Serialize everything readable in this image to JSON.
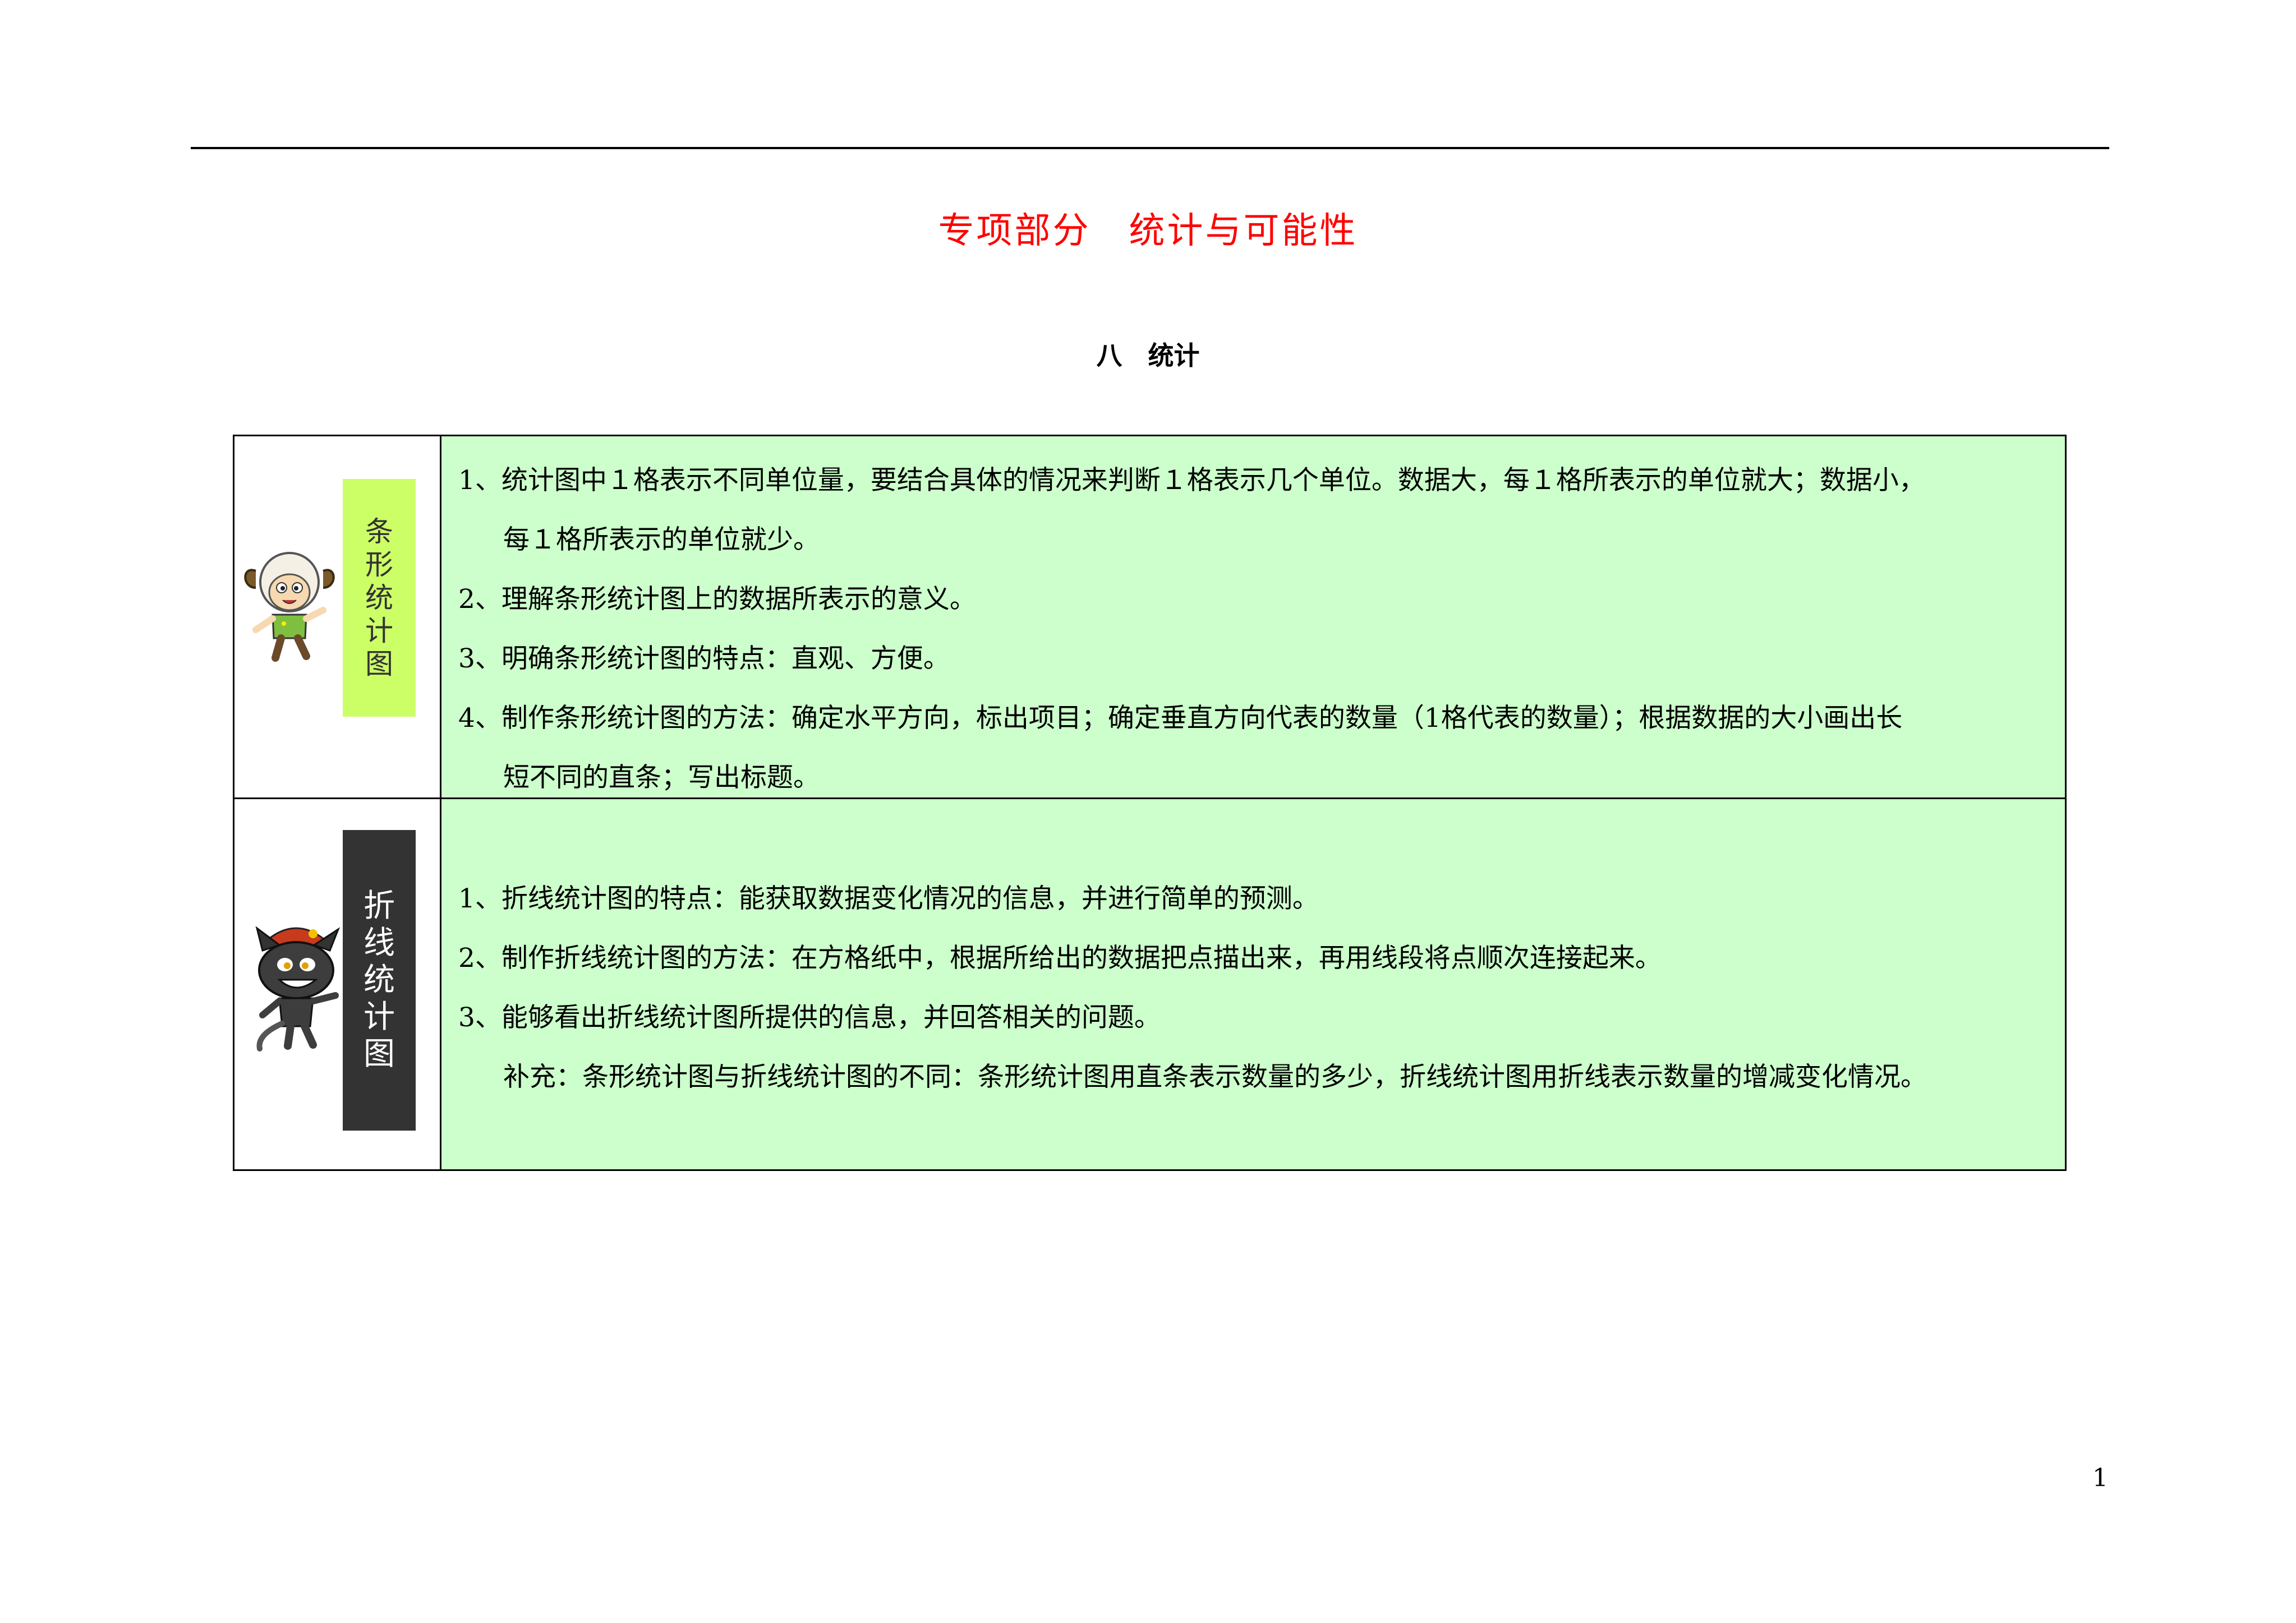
{
  "document": {
    "title": "专项部分　统计与可能性",
    "section_title": "八　统计",
    "page_number": "1"
  },
  "table": {
    "rows": [
      {
        "label_chars": [
          "条",
          "形",
          "统",
          "计",
          "图"
        ],
        "mascot_icon": "sheep-mascot-icon",
        "label_bg_color": "#ccff66",
        "lines": [
          "1、统计图中１格表示不同单位量，要结合具体的情况来判断１格表示几个单位。数据大，每１格所表示的单位就大；数据小，",
          "每１格所表示的单位就少。",
          "2、理解条形统计图上的数据所表示的意义。",
          "3、明确条形统计图的特点：直观、方便。",
          "4、制作条形统计图的方法：确定水平方向，标出项目；确定垂直方向代表的数量（1格代表的数量）；根据数据的大小画出长",
          "短不同的直条；写出标题。"
        ]
      },
      {
        "label_chars": [
          "折",
          "线",
          "统",
          "计",
          "图"
        ],
        "mascot_icon": "wolf-mascot-icon",
        "label_bg_color": "#333333",
        "lines": [
          "1、折线统计图的特点：能获取数据变化情况的信息，并进行简单的预测。",
          "2、制作折线统计图的方法：在方格纸中，根据所给出的数据把点描出来，再用线段将点顺次连接起来。",
          "3、能够看出折线统计图所提供的信息，并回答相关的问题。",
          "补充：条形统计图与折线统计图的不同：条形统计图用直条表示数量的多少，折线统计图用折线表示数量的增减变化情况。"
        ]
      }
    ],
    "content_bg_color": "#ccffcc"
  }
}
